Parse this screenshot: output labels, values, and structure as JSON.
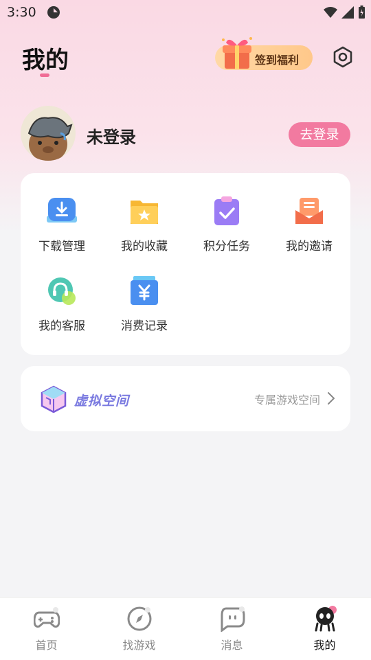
{
  "status_bar": {
    "time": "3:30"
  },
  "header": {
    "title": "我的",
    "sign_in_label": "签到福利"
  },
  "profile": {
    "username": "未登录",
    "login_label": "去登录"
  },
  "features": [
    {
      "label": "下载管理",
      "icon": "download-icon"
    },
    {
      "label": "我的收藏",
      "icon": "star-folder-icon"
    },
    {
      "label": "积分任务",
      "icon": "task-clipboard-icon"
    },
    {
      "label": "我的邀请",
      "icon": "invite-mail-icon"
    },
    {
      "label": "我的客服",
      "icon": "headset-icon"
    },
    {
      "label": "消费记录",
      "icon": "yen-receipt-icon"
    }
  ],
  "virtual_space": {
    "name": "虚拟空间",
    "link": "专属游戏空间"
  },
  "tabbar": {
    "tabs": [
      {
        "label": "首页",
        "icon": "gamepad-icon"
      },
      {
        "label": "找游戏",
        "icon": "compass-icon"
      },
      {
        "label": "消息",
        "icon": "chat-icon"
      },
      {
        "label": "我的",
        "icon": "profile-icon"
      }
    ],
    "active": "我的"
  },
  "colors": {
    "accent_pink": "#f27aa0",
    "background": "#f4f4f6"
  }
}
